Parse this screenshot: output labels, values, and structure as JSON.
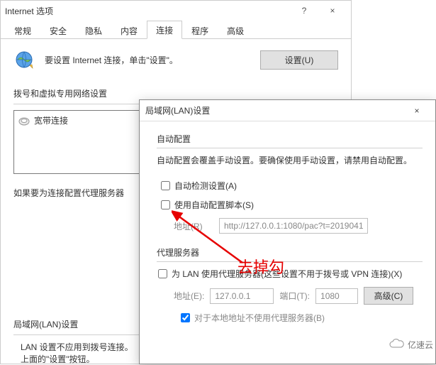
{
  "parent": {
    "title": "Internet 选项",
    "help_glyph": "?",
    "close_glyph": "×",
    "tabs": [
      "常规",
      "安全",
      "隐私",
      "内容",
      "连接",
      "程序",
      "高级"
    ],
    "active_tab_index": 4,
    "setup_text": "要设置 Internet 连接，单击\"设置\"。",
    "setup_button": "设置(U)",
    "dial_section_label": "拨号和虚拟专用网络设置",
    "broadband_label": "宽带连接",
    "proxy_hint": "如果要为连接配置代理服务器",
    "lan_section_label": "局域网(LAN)设置",
    "lan_desc_line1": "LAN 设置不应用到拨号连接。",
    "lan_desc_line2": "上面的\"设置\"按钮。"
  },
  "child": {
    "title": "局域网(LAN)设置",
    "close_glyph": "×",
    "auto_group_label": "自动配置",
    "auto_group_desc": "自动配置会覆盖手动设置。要确保使用手动设置，请禁用自动配置。",
    "chk_auto_detect": "自动检测设置(A)",
    "chk_use_script": "使用自动配置脚本(S)",
    "addr_label": "地址(R)",
    "addr_value": "http://127.0.0.1:1080/pac?t=2019041",
    "proxy_group_label": "代理服务器",
    "chk_proxy_lan": "为 LAN 使用代理服务器(这些设置不用于拨号或 VPN 连接)(X)",
    "proxy_addr_label": "地址(E):",
    "proxy_addr_value": "127.0.0.1",
    "proxy_port_label": "端口(T):",
    "proxy_port_value": "1080",
    "btn_advanced": "高级(C)",
    "chk_bypass_local": "对于本地地址不使用代理服务器(B)",
    "chk_auto_detect_checked": false,
    "chk_use_script_checked": false,
    "chk_proxy_lan_checked": false,
    "chk_bypass_local_checked": true
  },
  "annotation": "去掉勾",
  "watermark": "亿速云"
}
